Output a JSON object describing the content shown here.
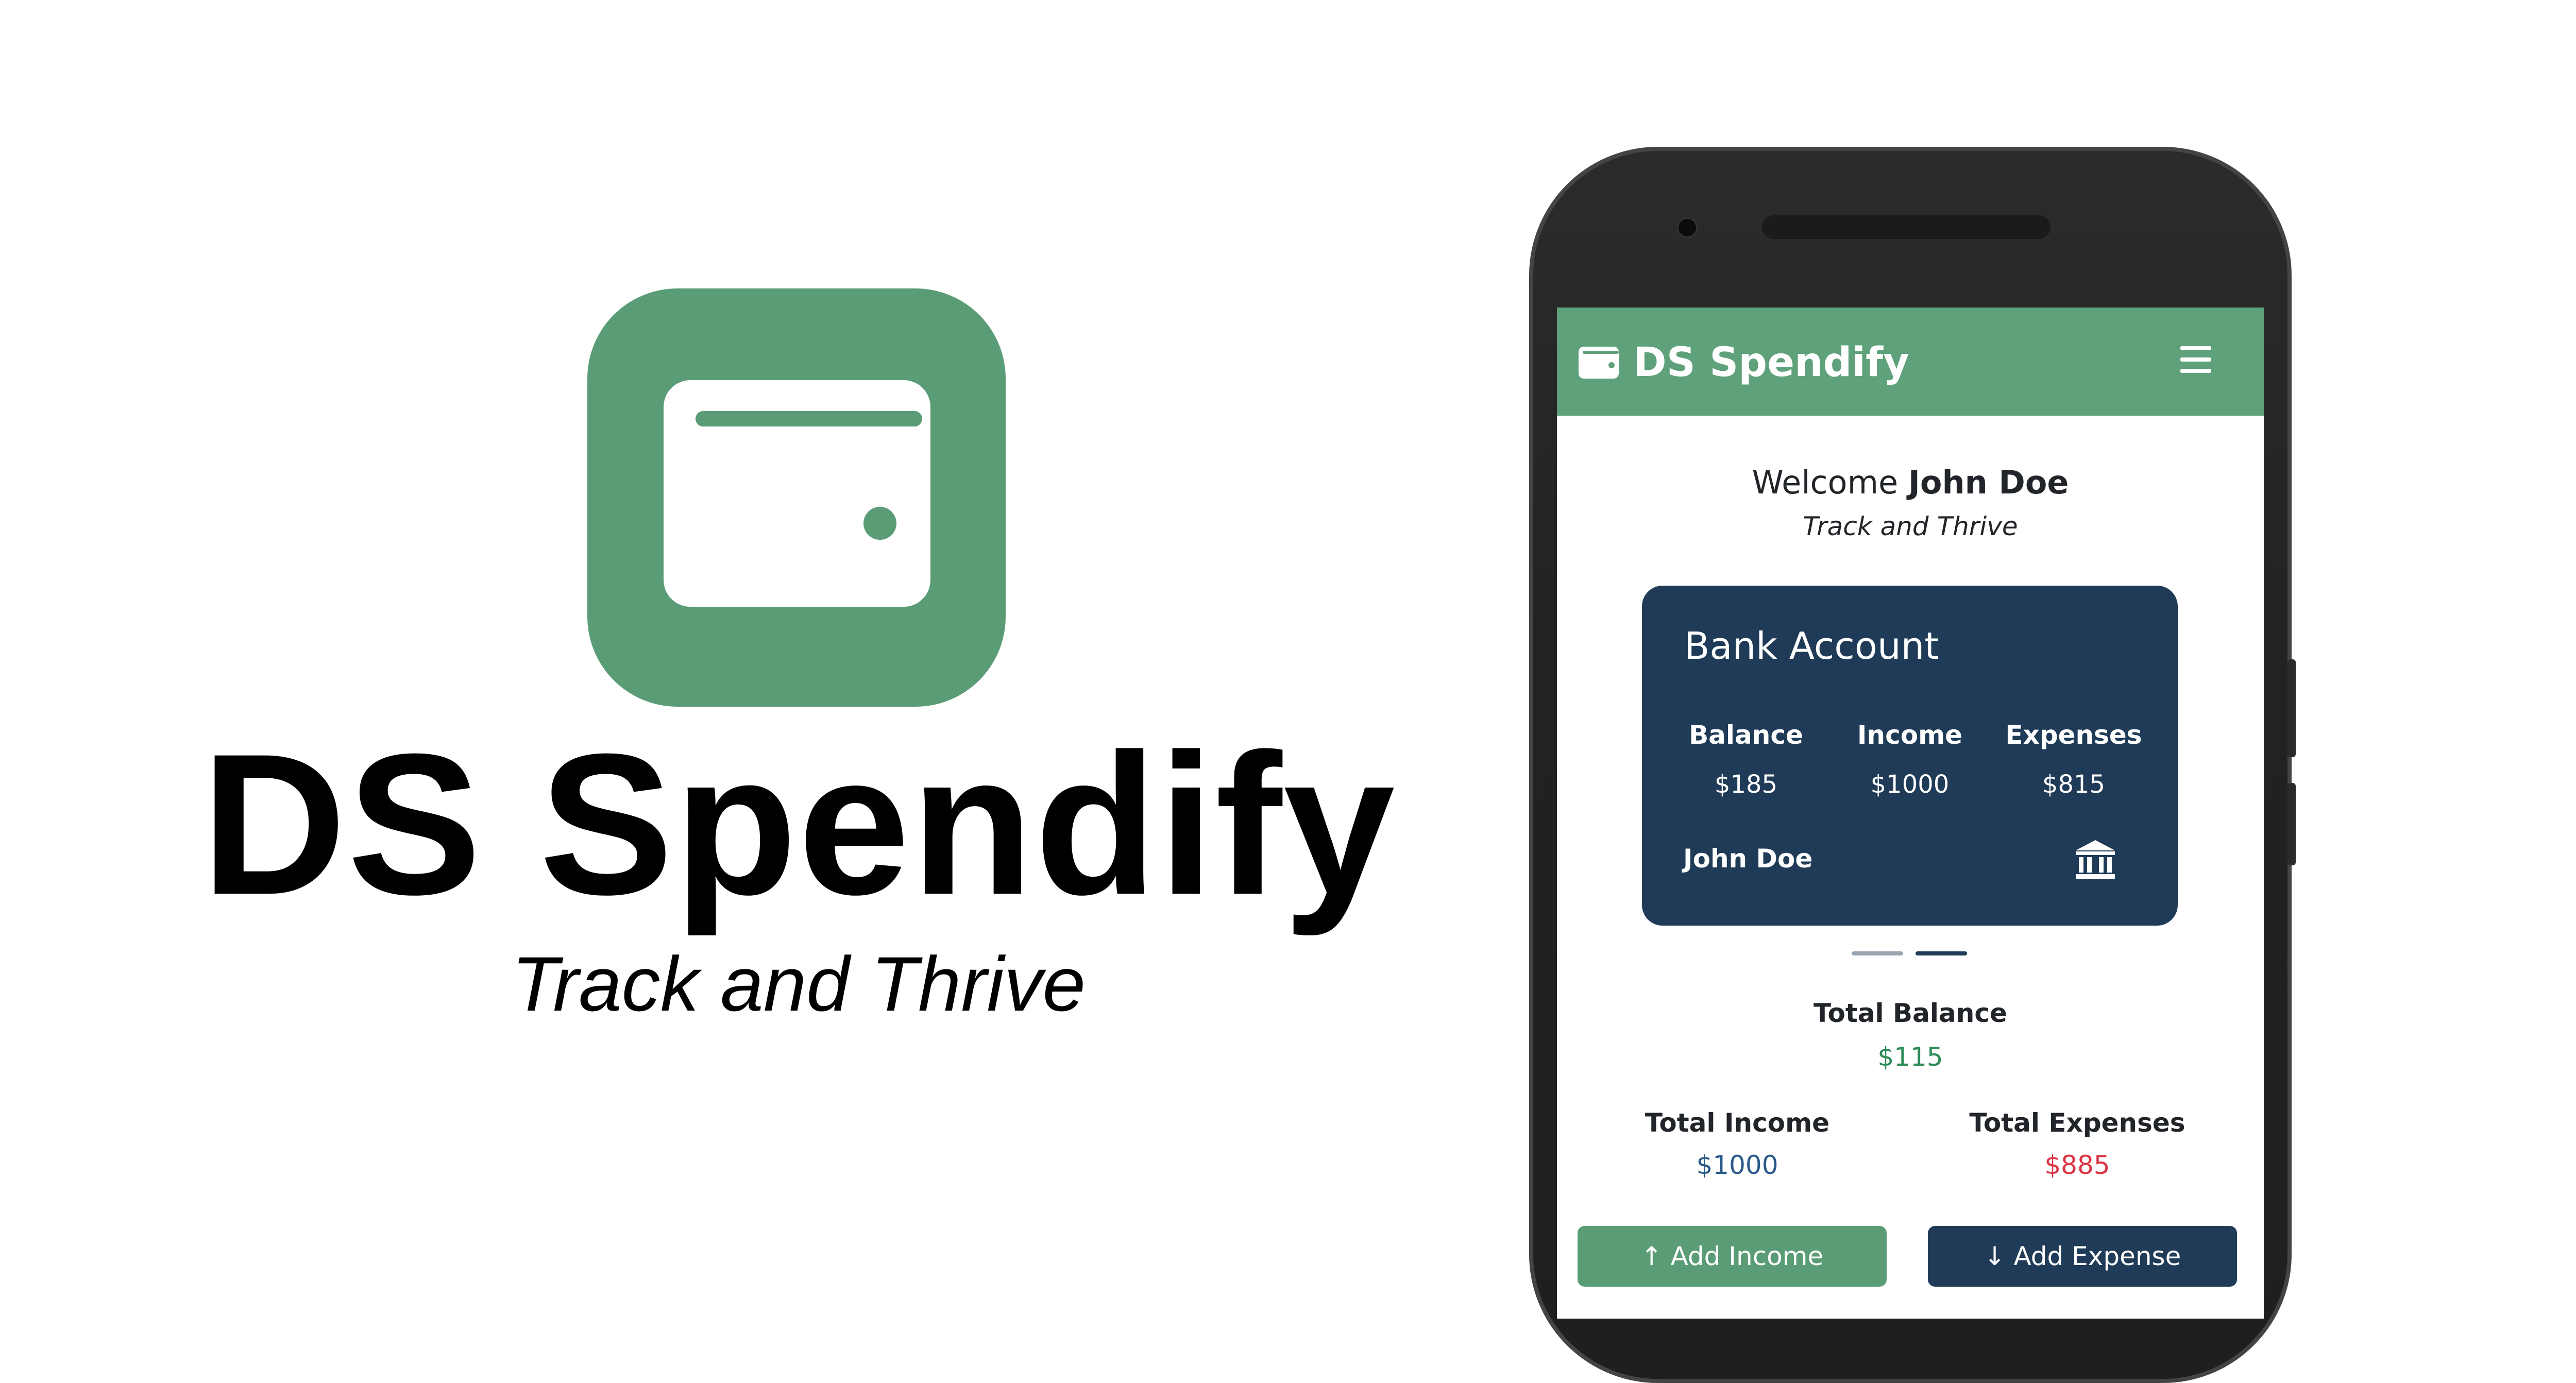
{
  "hero": {
    "logo_icon": "wallet-icon",
    "brand_color": "#5a9c76",
    "title": "DS Spendify",
    "tagline": "Track and Thrive"
  },
  "app": {
    "header": {
      "title": "DS Spendify",
      "logo_icon": "wallet-icon",
      "menu_icon": "hamburger-menu-icon",
      "color": "#5ea17a"
    },
    "welcome": {
      "prefix": "Welcome",
      "user_name": "John Doe",
      "subtitle": "Track and Thrive"
    },
    "account_card": {
      "title": "Bank Account",
      "color": "#1f3b57",
      "stats": [
        {
          "label": "Balance",
          "value": "$185"
        },
        {
          "label": "Income",
          "value": "$1000"
        },
        {
          "label": "Expenses",
          "value": "$815"
        }
      ],
      "owner": "John Doe",
      "icon": "bank-icon"
    },
    "carousel": {
      "slide_count": 2,
      "active_index": 1
    },
    "summary": {
      "total_balance_label": "Total Balance",
      "total_balance_value": "$115",
      "total_income_label": "Total Income",
      "total_income_value": "$1000",
      "total_expenses_label": "Total Expenses",
      "total_expenses_value": "$885",
      "colors": {
        "balance": "#2e8b57",
        "income": "#2a5a8a",
        "expenses": "#dc3545"
      }
    },
    "actions": {
      "add_income": "Add Income",
      "add_expense": "Add Expense"
    }
  }
}
